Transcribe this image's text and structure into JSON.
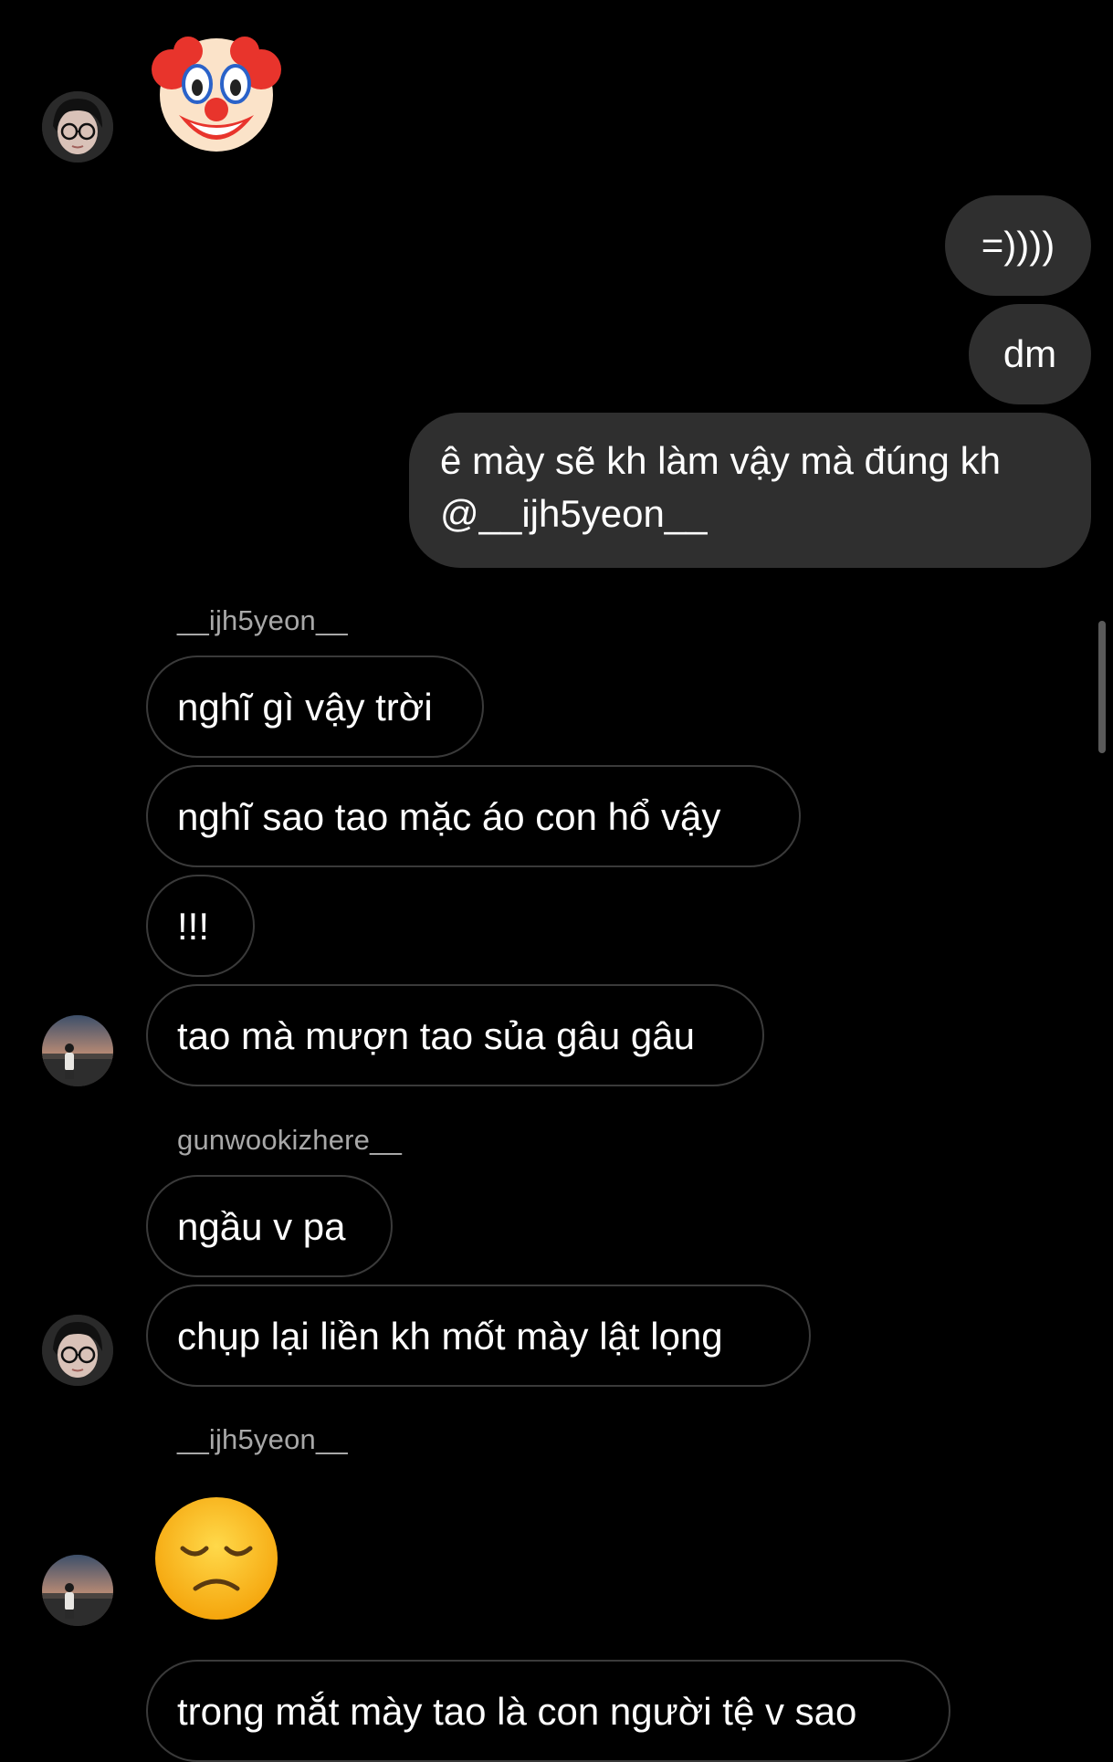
{
  "thread": {
    "emojis": {
      "clown": "clown-face-emoji",
      "pensive": "disappointed-face-emoji"
    },
    "outgoing": [
      {
        "text": "=))))"
      },
      {
        "text": "dm"
      },
      {
        "text_line1": "ê mày sẽ kh làm vậy mà đúng kh",
        "text_line2": "@__ijh5yeon__"
      }
    ],
    "groups": [
      {
        "sender": "__ijh5yeon__",
        "messages": [
          "nghĩ gì vậy trời",
          "nghĩ sao tao mặc áo con hổ vậy",
          "!!!",
          "tao mà mượn tao sủa gâu gâu"
        ]
      },
      {
        "sender": "gunwookizhere__",
        "messages": [
          "ngầu v pa",
          "chụp lại liền kh mốt mày lật lọng"
        ]
      },
      {
        "sender": "__ijh5yeon__",
        "messages": [
          "trong mắt mày tao là con người tệ v sao"
        ]
      }
    ]
  },
  "colors": {
    "background": "#000000",
    "outgoing_bubble": "#2f2f2f",
    "incoming_border": "#3a3a3a",
    "sender_name": "#a8a8a8"
  }
}
